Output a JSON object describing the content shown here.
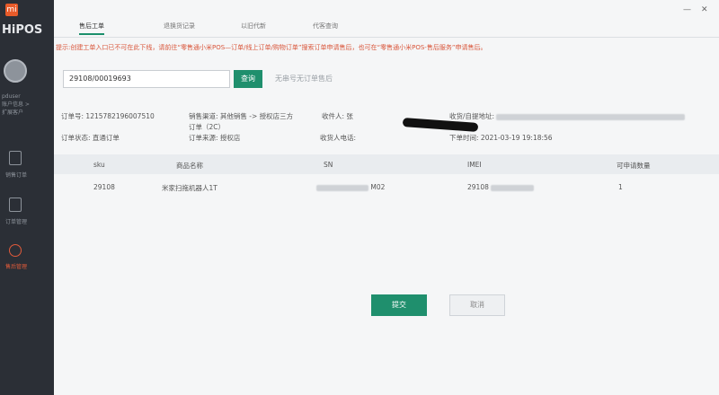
{
  "sidebar": {
    "logo": "mi",
    "brand": "HiPOS",
    "user_line1": "pduser",
    "user_line2": "账户信息 >",
    "user_line3": "扩展客户",
    "items": [
      {
        "label": "销售订单"
      },
      {
        "label": "订单管理"
      },
      {
        "label": "售后管理"
      }
    ]
  },
  "tabs": [
    {
      "label": "售后工单"
    },
    {
      "label": "退换货记录"
    },
    {
      "label": "以旧代新"
    },
    {
      "label": "代客查询"
    }
  ],
  "window_controls": {
    "minimize": "—",
    "close": "✕"
  },
  "notice": "提示:创建工单入口已不可在此下线，请前往“零售通小米POS—订单/线上订单/购物订单”搜索订单申请售后，也可在“零售通小米POS-售后服务”申请售后。",
  "search": {
    "value": "29108/00019693",
    "button": "查询",
    "no_order_link": "无串号无订单售后"
  },
  "order": {
    "order_no_label": "订单号:",
    "order_no": "1215782196007510",
    "channel_label": "销售渠道:",
    "channel": "其他销售 -> 授权店三方",
    "channel_extra": "订单（2C）",
    "receiver_label": "收件人:",
    "receiver": "张",
    "address_label": "收货/自提地址:",
    "address_tail": "址",
    "status_label": "订单状态:",
    "status": "直通订单",
    "source_label": "订单来源:",
    "source": "授权店",
    "phone_label": "收货人电话:",
    "time_label": "下单时间:",
    "time": "2021-03-19 19:18:56"
  },
  "table": {
    "headers": [
      "sku",
      "商品名称",
      "SN",
      "IMEI",
      "可申请数量"
    ],
    "rows": [
      {
        "sku": "29108",
        "name": "米家扫拖机器人1T",
        "sn_tail": "M02",
        "imei_head": "29108",
        "qty": "1"
      }
    ]
  },
  "actions": {
    "submit": "提交",
    "cancel": "取消"
  }
}
